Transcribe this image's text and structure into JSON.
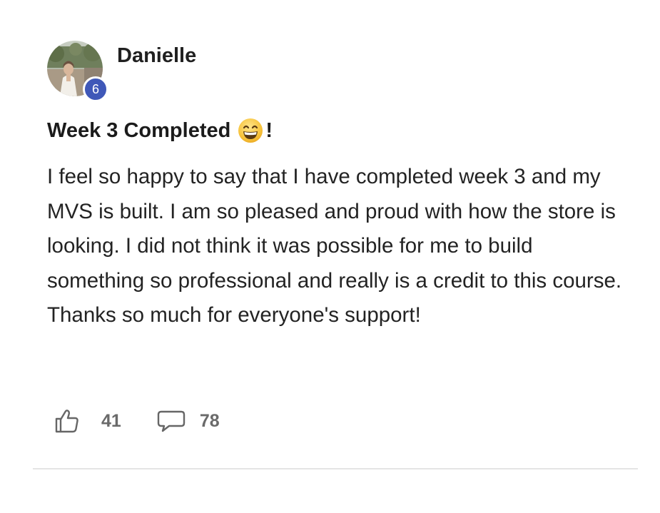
{
  "post": {
    "author": "Danielle",
    "level": "6",
    "title": "Week 3 Completed",
    "title_suffix": "!",
    "title_emoji": "grinning-face-emoji",
    "body": "I feel so happy to say that I have completed week 3 and my MVS is built. I am so pleased and proud with how the store is looking. I did not think it was possible for me to build something so professional and really is a credit to this course. Thanks so much for everyone's support!"
  },
  "actions": {
    "like_icon": "thumbs-up-icon",
    "like_count": "41",
    "comment_icon": "comment-bubble-icon",
    "comment_count": "78"
  },
  "colors": {
    "badge": "#3f58b8",
    "text": "#232323",
    "muted": "#6a6a6a",
    "divider": "#e4e4e4"
  }
}
